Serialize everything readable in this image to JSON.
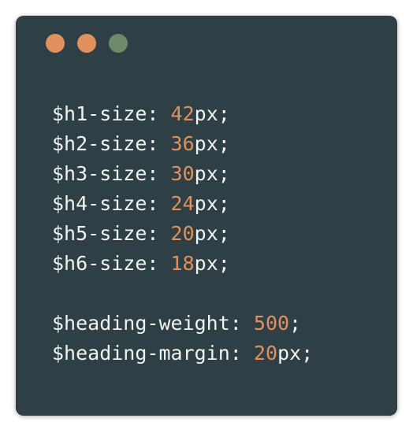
{
  "colors": {
    "background": "#2e3f46",
    "text": "#f2f2f2",
    "number": "#e0915d",
    "dot_close": "#e0915d",
    "dot_minimize": "#e0915d",
    "dot_maximize": "#6e8a6a"
  },
  "window_dots": [
    {
      "name": "close",
      "color": "#e0915d"
    },
    {
      "name": "minimize",
      "color": "#e0915d"
    },
    {
      "name": "maximize",
      "color": "#6e8a6a"
    }
  ],
  "code_lines": [
    {
      "var": "$h1-size",
      "sep": ": ",
      "num": "42",
      "unit": "px",
      "end": ";"
    },
    {
      "var": "$h2-size",
      "sep": ": ",
      "num": "36",
      "unit": "px",
      "end": ";"
    },
    {
      "var": "$h3-size",
      "sep": ": ",
      "num": "30",
      "unit": "px",
      "end": ";"
    },
    {
      "var": "$h4-size",
      "sep": ": ",
      "num": "24",
      "unit": "px",
      "end": ";"
    },
    {
      "var": "$h5-size",
      "sep": ": ",
      "num": "20",
      "unit": "px",
      "end": ";"
    },
    {
      "var": "$h6-size",
      "sep": ": ",
      "num": "18",
      "unit": "px",
      "end": ";"
    },
    null,
    {
      "var": "$heading-weight",
      "sep": ": ",
      "num": "500",
      "unit": "",
      "end": ";"
    },
    {
      "var": "$heading-margin",
      "sep": ": ",
      "num": "20",
      "unit": "px",
      "end": ";"
    }
  ]
}
